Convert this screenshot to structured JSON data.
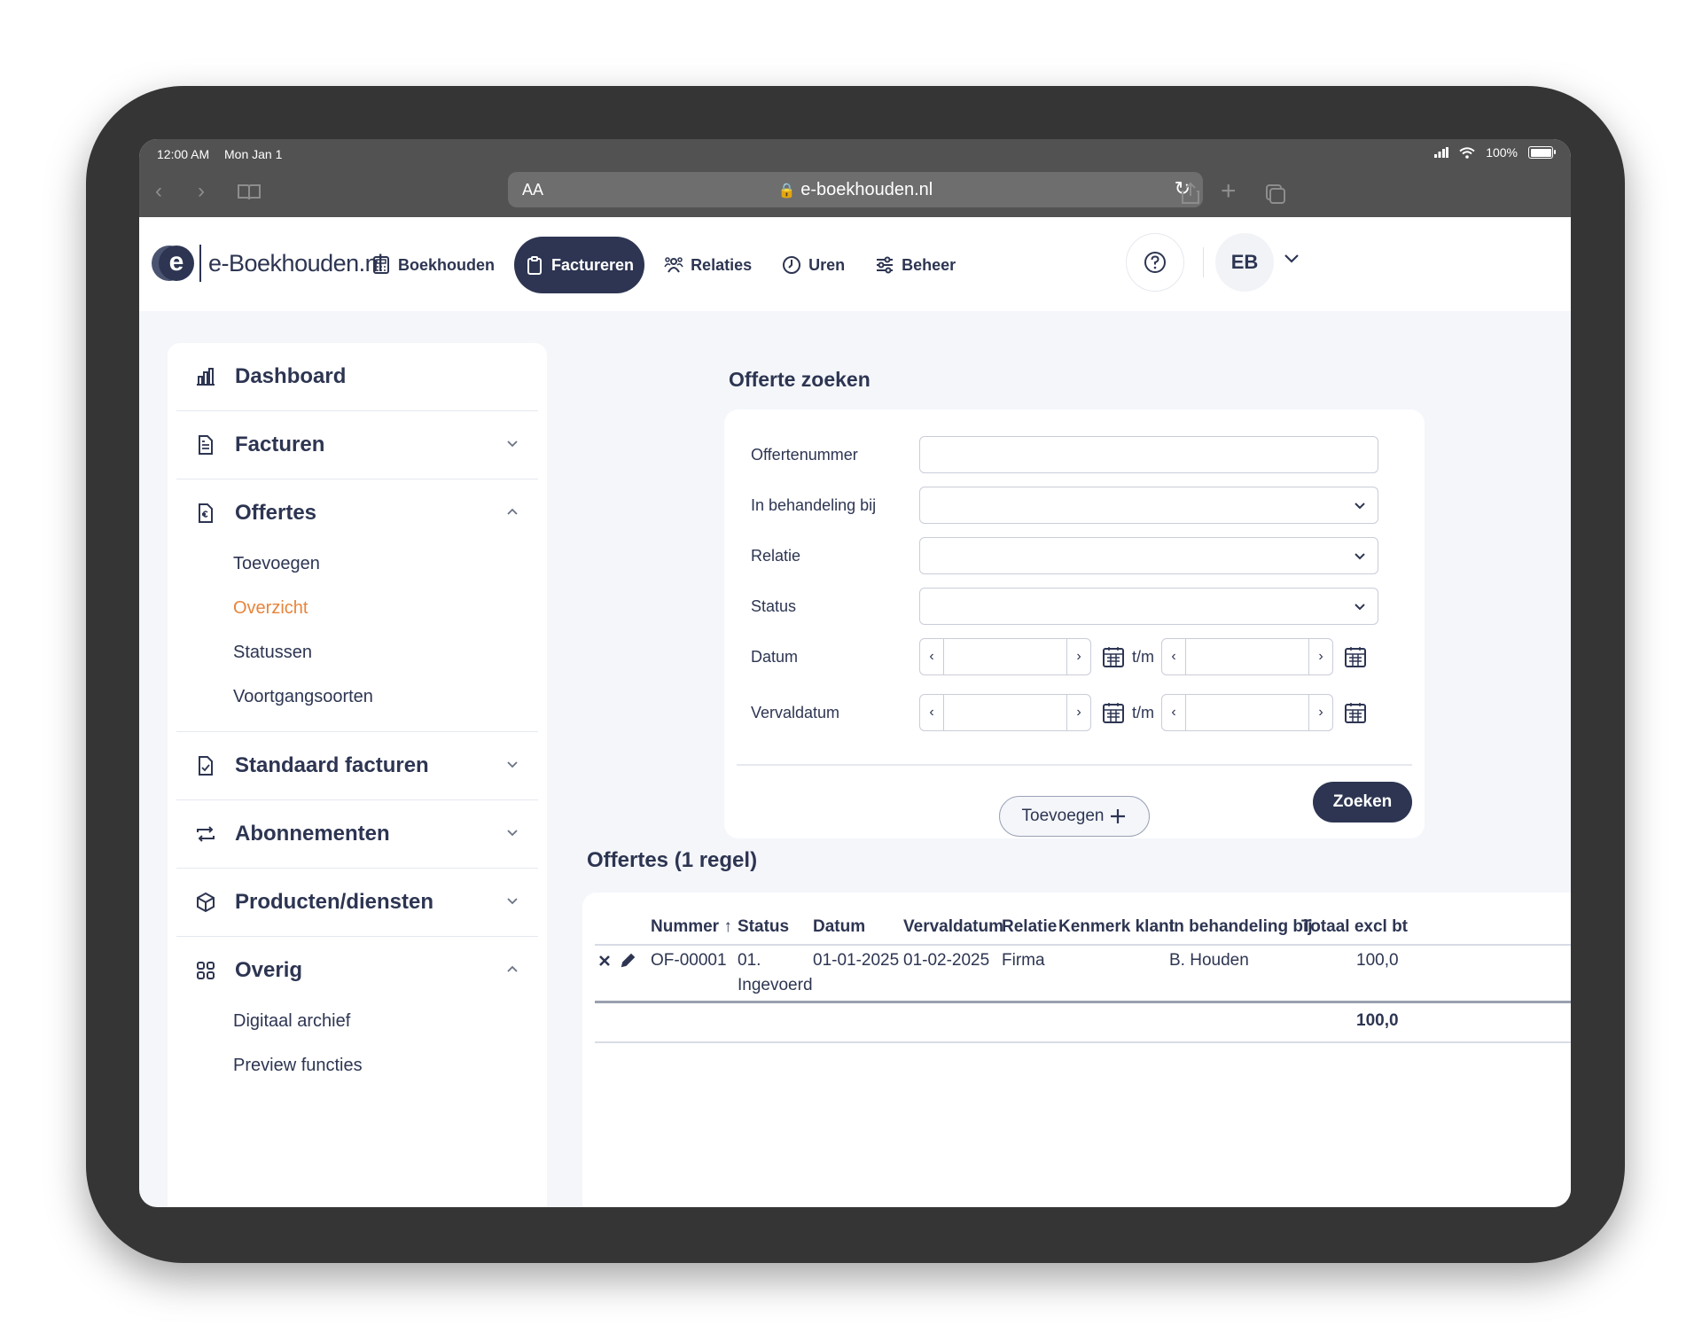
{
  "status_bar": {
    "time": "12:00 AM",
    "date": "Mon Jan 1",
    "battery": "100%"
  },
  "browser": {
    "aa_label": "AA",
    "url": "e-boekhouden.nl"
  },
  "header": {
    "logo_text": "e-Boekhouden.nl",
    "nav": [
      {
        "label": "Boekhouden",
        "icon": "calculator-icon"
      },
      {
        "label": "Factureren",
        "icon": "clipboard-icon",
        "active": true
      },
      {
        "label": "Relaties",
        "icon": "people-icon"
      },
      {
        "label": "Uren",
        "icon": "clock-icon"
      },
      {
        "label": "Beheer",
        "icon": "sliders-icon"
      }
    ],
    "avatar_initials": "EB"
  },
  "sidebar": {
    "dashboard": "Dashboard",
    "facturen": "Facturen",
    "offertes": "Offertes",
    "offertes_items": [
      "Toevoegen",
      "Overzicht",
      "Statussen",
      "Voortgangsoorten"
    ],
    "standaard_facturen": "Standaard facturen",
    "abonnementen": "Abonnementen",
    "producten": "Producten/diensten",
    "overig": "Overig",
    "overig_items": [
      "Digitaal archief",
      "Preview functies"
    ]
  },
  "search": {
    "title": "Offerte zoeken",
    "labels": {
      "offertenummer": "Offertenummer",
      "behandeling": "In behandeling bij",
      "relatie": "Relatie",
      "status": "Status",
      "datum": "Datum",
      "vervaldatum": "Vervaldatum"
    },
    "range_sep": "t/m",
    "button": "Zoeken"
  },
  "add_button": "Toevoegen",
  "results": {
    "title": "Offertes (1 regel)",
    "columns": [
      "Nummer ↑",
      "Status",
      "Datum",
      "Vervaldatum",
      "Relatie",
      "Kenmerk klant",
      "In behandeling bij",
      "Totaal excl bt"
    ],
    "rows": [
      {
        "nummer": "OF-00001",
        "status_line1": "01.",
        "status_line2": "Ingevoerd",
        "datum": "01-01-2025",
        "vervaldatum": "01-02-2025",
        "relatie": "Firma",
        "kenmerk": "",
        "behandeling": "B. Houden",
        "totaal": "100,0"
      }
    ],
    "total": "100,0"
  },
  "colors": {
    "primary": "#2d3552",
    "accent": "#e8843a",
    "background": "#f4f6fa"
  }
}
